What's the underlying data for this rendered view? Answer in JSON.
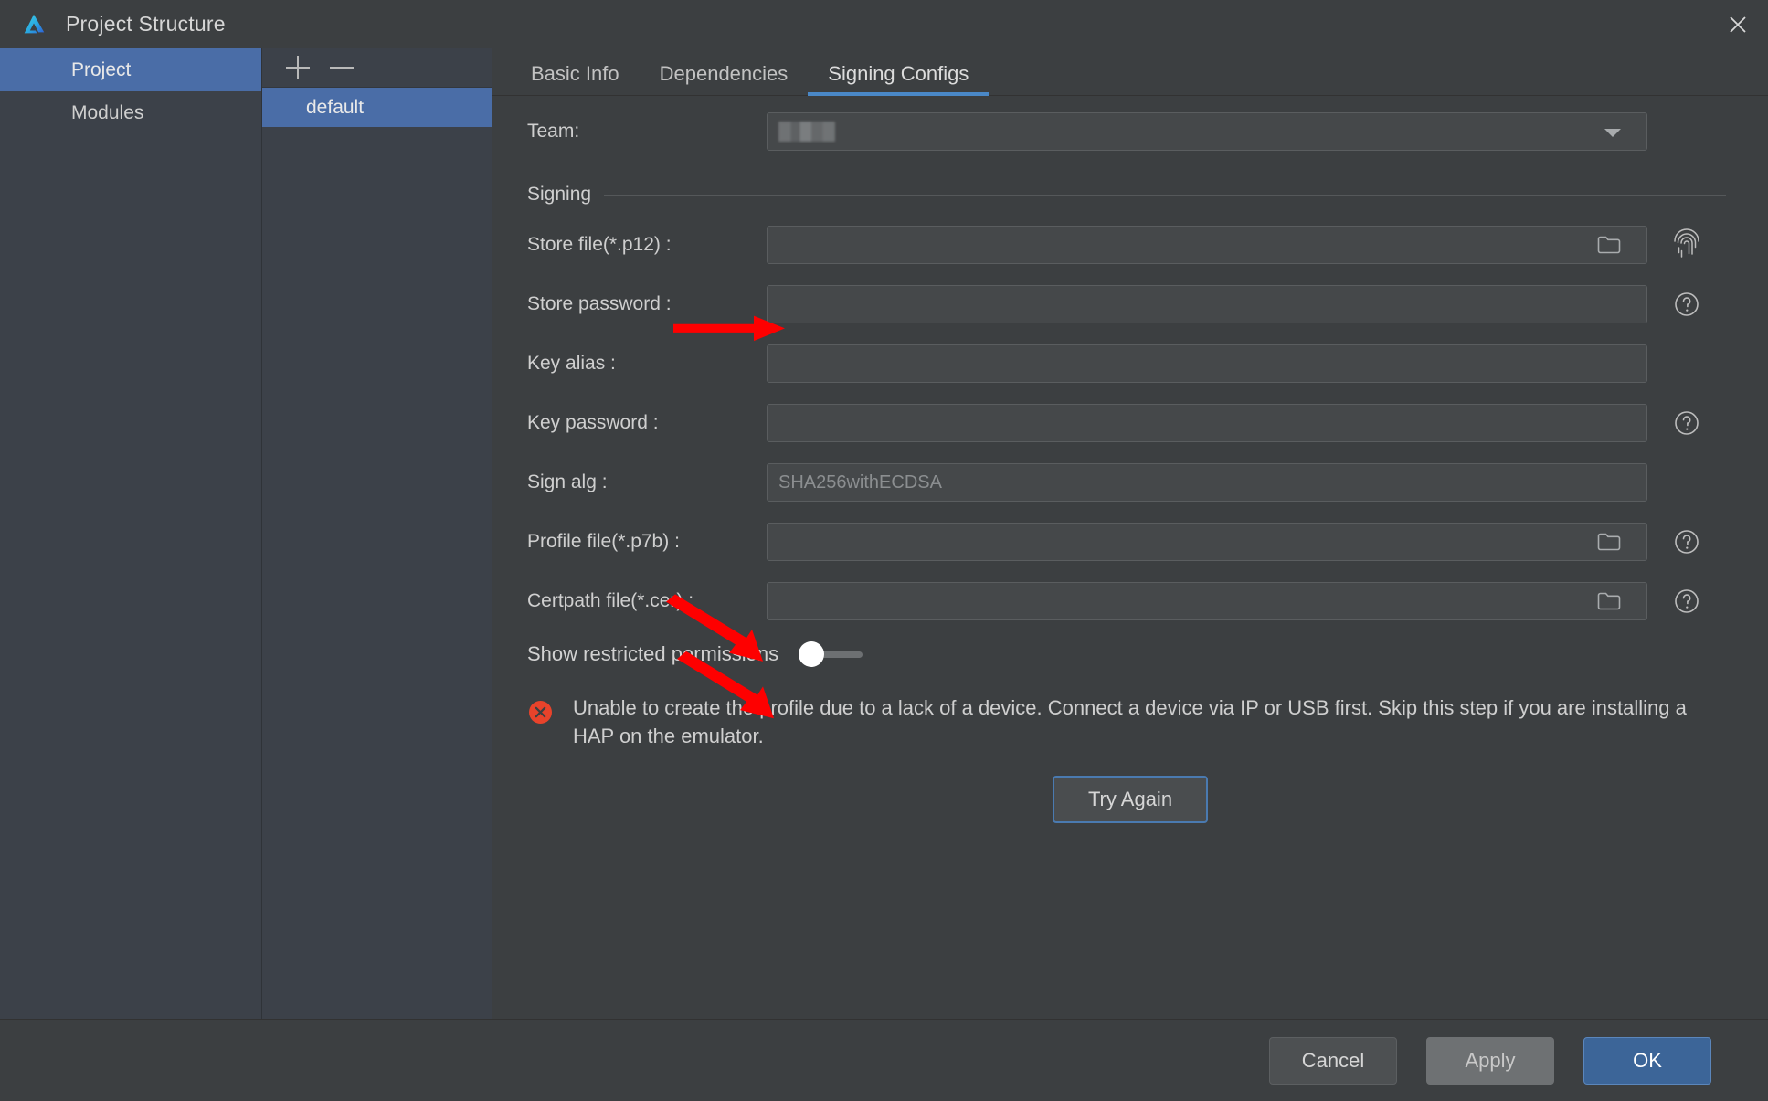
{
  "window": {
    "title": "Project Structure",
    "logo_icon": "deveco-logo-icon",
    "close_icon": "close-icon"
  },
  "sidebar": {
    "items": [
      {
        "label": "Project",
        "selected": true
      },
      {
        "label": "Modules",
        "selected": false
      }
    ]
  },
  "config_panel": {
    "add_icon": "plus-icon",
    "remove_icon": "minus-icon",
    "items": [
      {
        "label": "default",
        "selected": true
      }
    ]
  },
  "tabs": [
    {
      "label": "Basic Info",
      "active": false
    },
    {
      "label": "Dependencies",
      "active": false
    },
    {
      "label": "Signing Configs",
      "active": true
    }
  ],
  "form": {
    "team": {
      "label": "Team:",
      "value": "",
      "redacted": true,
      "dropdown_icon": "chevron-down-icon"
    },
    "section_title": "Signing",
    "fields": [
      {
        "label": "Store file(*.p12) :",
        "value": "",
        "placeholder": "",
        "has_folder": true,
        "folder_icon": "folder-icon",
        "side_icon": "fingerprint-icon",
        "arrow": true
      },
      {
        "label": "Store password :",
        "value": "",
        "placeholder": "",
        "has_folder": false,
        "side_icon": "help-circle-icon",
        "arrow": false
      },
      {
        "label": "Key alias :",
        "value": "",
        "placeholder": "",
        "has_folder": false,
        "side_icon": "",
        "arrow": false
      },
      {
        "label": "Key password :",
        "value": "",
        "placeholder": "",
        "has_folder": false,
        "side_icon": "help-circle-icon",
        "arrow": false
      },
      {
        "label": "Sign alg :",
        "value": "SHA256withECDSA",
        "placeholder": "SHA256withECDSA",
        "has_folder": false,
        "side_icon": "",
        "arrow": false,
        "muted": true
      },
      {
        "label": "Profile file(*.p7b) :",
        "value": "",
        "placeholder": "",
        "has_folder": true,
        "folder_icon": "folder-icon",
        "side_icon": "help-circle-icon",
        "arrow": true
      },
      {
        "label": "Certpath file(*.cer) :",
        "value": "",
        "placeholder": "",
        "has_folder": true,
        "folder_icon": "folder-icon",
        "side_icon": "help-circle-icon",
        "arrow": true
      }
    ],
    "toggle": {
      "label": "Show restricted permissions",
      "state": "off"
    }
  },
  "error": {
    "icon": "error-circle-icon",
    "message": "Unable to create the profile due to a lack of a device. Connect a device via IP or USB first. Skip this step if you are installing a HAP on the emulator.",
    "action_label": "Try Again"
  },
  "footer": {
    "cancel_label": "Cancel",
    "apply_label": "Apply",
    "ok_label": "OK"
  },
  "colors": {
    "dialog_bg": "#3c3f41",
    "sidebar_bg": "#3c4149",
    "accent_blue": "#4a6da7",
    "tab_underline": "#4a88c7",
    "ok_button": "#3c6598",
    "error_red": "#e8432b",
    "annotation_arrow": "#fe0000"
  }
}
